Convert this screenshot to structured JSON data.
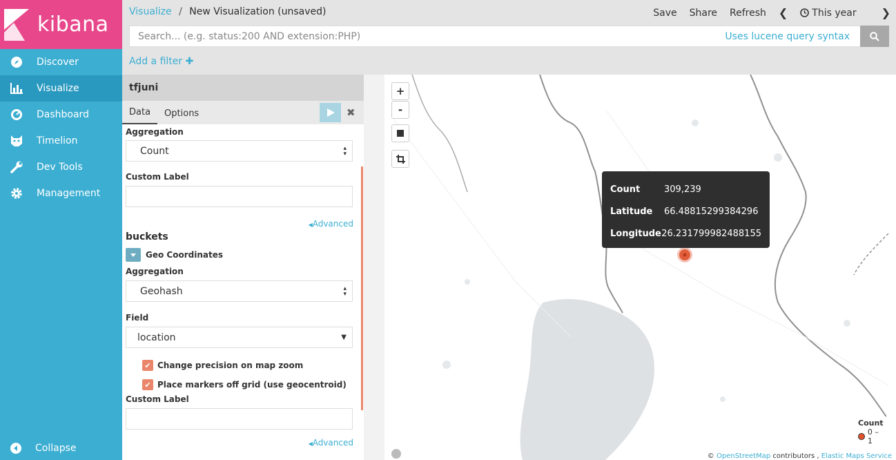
{
  "brand": {
    "name": "kibana"
  },
  "sidebar": {
    "items": [
      {
        "label": "Discover",
        "icon": "compass-icon"
      },
      {
        "label": "Visualize",
        "icon": "bar-chart-icon"
      },
      {
        "label": "Dashboard",
        "icon": "gauge-icon"
      },
      {
        "label": "Timelion",
        "icon": "cat-icon"
      },
      {
        "label": "Dev Tools",
        "icon": "wrench-icon"
      },
      {
        "label": "Management",
        "icon": "gear-icon"
      }
    ],
    "active": "Visualize",
    "collapse_label": "Collapse"
  },
  "header": {
    "breadcrumb_link": "Visualize",
    "breadcrumb_sep": "/",
    "breadcrumb_current": "New Visualization (unsaved)",
    "save": "Save",
    "share": "Share",
    "refresh": "Refresh",
    "timerange": "This year"
  },
  "search": {
    "placeholder": "Search... (e.g. status:200 AND extension:PHP)",
    "value": "",
    "syntax_link": "Uses lucene query syntax"
  },
  "filter": {
    "add_label": "Add a filter"
  },
  "editor": {
    "index_name": "tfjuni",
    "tabs": [
      "Data",
      "Options"
    ],
    "metric_aggregation_label": "Aggregation",
    "metric_aggregation_value": "Count",
    "custom_label_label": "Custom Label",
    "advanced_label": "Advanced",
    "buckets_heading": "buckets",
    "bucket_type": "Geo Coordinates",
    "bucket_aggregation_label": "Aggregation",
    "bucket_aggregation_value": "Geohash",
    "field_label": "Field",
    "field_value": "location",
    "check_precision": "Change precision on map zoom",
    "check_geocentroid": "Place markers off grid (use geocentroid)",
    "custom_label2_label": "Custom Label",
    "advanced2_label": "Advanced"
  },
  "map": {
    "zoom_in": "+",
    "zoom_out": "-",
    "tooltip": {
      "count_key": "Count",
      "count_val": "309,239",
      "lat_key": "Latitude",
      "lat_val": "66.48815299384296",
      "lon_key": "Longitude",
      "lon_val": "26.231799982488155"
    },
    "legend_title": "Count",
    "legend_range": "0 – 1",
    "attribution_prefix": "©",
    "attribution_osm": "OpenStreetMap",
    "attribution_mid": "contributors ,",
    "attribution_ems": "Elastic Maps Service",
    "marker_color": "#e0532d"
  },
  "colors": {
    "accent": "#3caed2",
    "brand": "#e8488b",
    "checkbox": "#e9866b"
  }
}
